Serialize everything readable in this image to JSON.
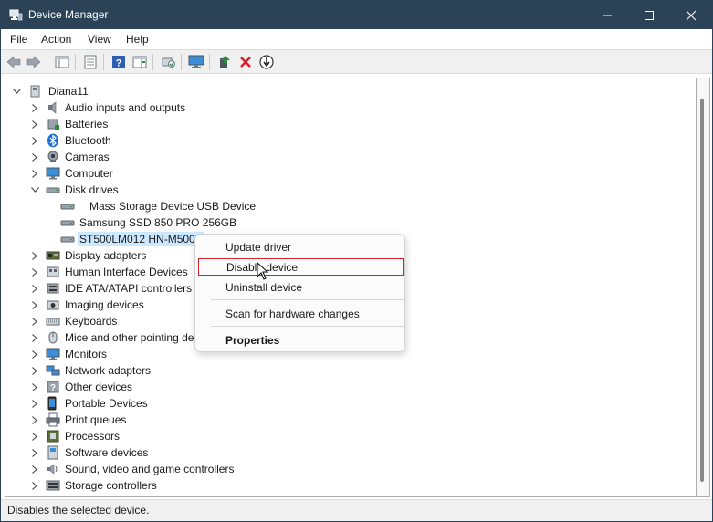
{
  "window": {
    "title": "Device Manager",
    "icon": "device-manager-icon"
  },
  "menu": [
    "File",
    "Action",
    "View",
    "Help"
  ],
  "toolbar": {
    "buttons": [
      "back-icon",
      "forward-icon",
      "show-hide-console-tree-icon",
      "properties-icon",
      "help-icon",
      "action-pane-icon",
      "scan-hardware-icon",
      "display-computer-icon",
      "update-driver-icon",
      "uninstall-icon",
      "disable-icon"
    ]
  },
  "tree": {
    "root": "Diana11",
    "categories": [
      {
        "label": "Audio inputs and outputs",
        "icon": "speaker-icon"
      },
      {
        "label": "Batteries",
        "icon": "battery-icon"
      },
      {
        "label": "Bluetooth",
        "icon": "bluetooth-icon"
      },
      {
        "label": "Cameras",
        "icon": "camera-icon"
      },
      {
        "label": "Computer",
        "icon": "monitor-icon"
      },
      {
        "label": "Disk drives",
        "icon": "disk-drive-icon"
      },
      {
        "label": "Display adapters",
        "icon": "display-adapter-icon"
      },
      {
        "label": "Human Interface Devices",
        "icon": "hid-icon"
      },
      {
        "label": "IDE ATA/ATAPI controllers",
        "icon": "ide-controller-icon"
      },
      {
        "label": "Imaging devices",
        "icon": "imaging-icon"
      },
      {
        "label": "Keyboards",
        "icon": "keyboard-icon"
      },
      {
        "label": "Mice and other pointing de",
        "icon": "mouse-icon"
      },
      {
        "label": "Monitors",
        "icon": "monitor-icon"
      },
      {
        "label": "Network adapters",
        "icon": "network-icon"
      },
      {
        "label": "Other devices",
        "icon": "unknown-device-icon"
      },
      {
        "label": "Portable Devices",
        "icon": "portable-device-icon"
      },
      {
        "label": "Print queues",
        "icon": "printer-icon"
      },
      {
        "label": "Processors",
        "icon": "processor-icon"
      },
      {
        "label": "Software devices",
        "icon": "software-device-icon"
      },
      {
        "label": "Sound, video and game controllers",
        "icon": "sound-icon"
      },
      {
        "label": "Storage controllers",
        "icon": "storage-controller-icon"
      }
    ],
    "disk_children": [
      "Mass Storage Device USB Device",
      "Samsung SSD 850 PRO 256GB",
      "ST500LM012 HN-M500N"
    ]
  },
  "context_menu": {
    "items": [
      "Update driver",
      "Disable device",
      "Uninstall device",
      "Scan for hardware changes",
      "Properties"
    ],
    "highlighted": "Disable device"
  },
  "status": "Disables the selected device."
}
